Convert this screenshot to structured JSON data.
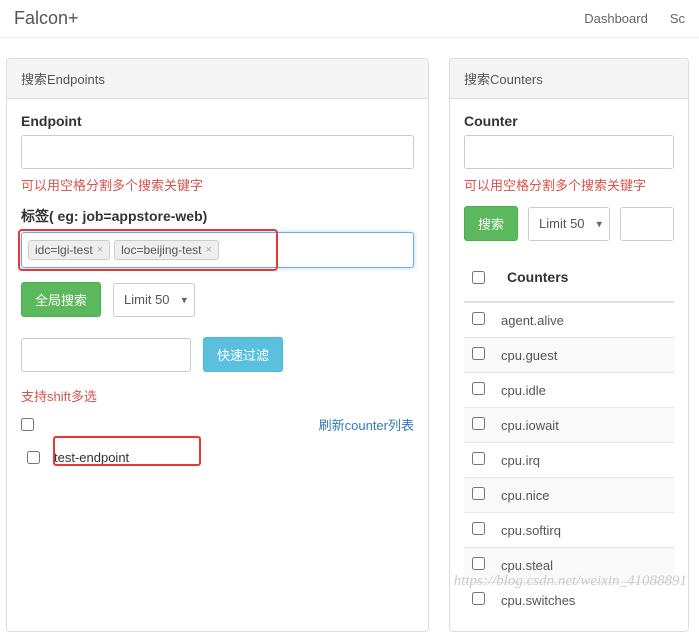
{
  "header": {
    "brand": "Falcon+",
    "nav": [
      "Dashboard",
      "Sc"
    ]
  },
  "left": {
    "title": "搜索Endpoints",
    "endpoint_label": "Endpoint",
    "hint1": "可以用空格分割多个搜索关键字",
    "tags_label": "标签( eg: job=appstore-web)",
    "tags": [
      "idc=lgi-test",
      "loc=beijing-test"
    ],
    "btn_global_search": "全局搜索",
    "limit": "Limit 50",
    "btn_filter": "快速过滤",
    "shift_hint": "支持shift多选",
    "refresh_link": "刷新counter列表",
    "endpoint_result": "test-endpoint"
  },
  "right": {
    "title": "搜索Counters",
    "counter_label": "Counter",
    "hint1": "可以用空格分割多个搜索关键字",
    "btn_search": "搜索",
    "limit": "Limit 50",
    "col_header": "Counters",
    "rows": [
      "agent.alive",
      "cpu.guest",
      "cpu.idle",
      "cpu.iowait",
      "cpu.irq",
      "cpu.nice",
      "cpu.softirq",
      "cpu.steal",
      "cpu.switches"
    ]
  },
  "watermark": "https://blog.csdn.net/weixin_41088891"
}
